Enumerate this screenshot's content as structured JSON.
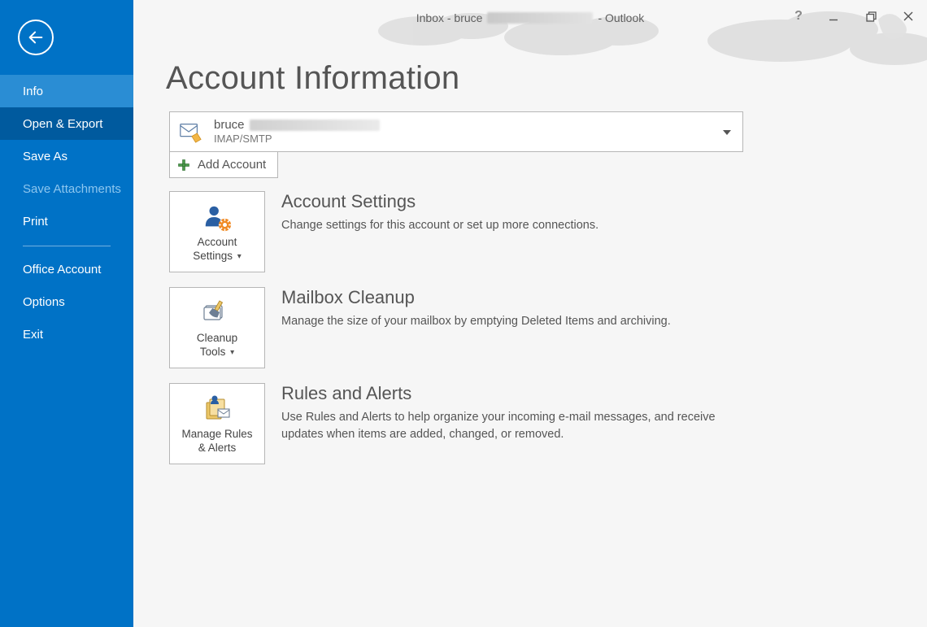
{
  "window": {
    "title_prefix": "Inbox - bruce",
    "title_suffix": "- Outlook"
  },
  "sidebar": {
    "items": [
      {
        "label": "Info"
      },
      {
        "label": "Open & Export"
      },
      {
        "label": "Save As"
      },
      {
        "label": "Save Attachments"
      },
      {
        "label": "Print"
      },
      {
        "label": "Office Account"
      },
      {
        "label": "Options"
      },
      {
        "label": "Exit"
      }
    ]
  },
  "page": {
    "title": "Account Information",
    "account": {
      "name": "bruce",
      "type": "IMAP/SMTP"
    },
    "add_account_label": "Add Account",
    "sections": [
      {
        "tile_line1": "Account",
        "tile_line2": "Settings",
        "has_caret": true,
        "heading": "Account Settings",
        "desc": "Change settings for this account or set up more connections."
      },
      {
        "tile_line1": "Cleanup",
        "tile_line2": "Tools",
        "has_caret": true,
        "heading": "Mailbox Cleanup",
        "desc": "Manage the size of your mailbox by emptying Deleted Items and archiving."
      },
      {
        "tile_line1": "Manage Rules",
        "tile_line2": "& Alerts",
        "has_caret": false,
        "heading": "Rules and Alerts",
        "desc": "Use Rules and Alerts to help organize your incoming e-mail messages, and receive updates when items are added, changed, or removed."
      }
    ]
  }
}
